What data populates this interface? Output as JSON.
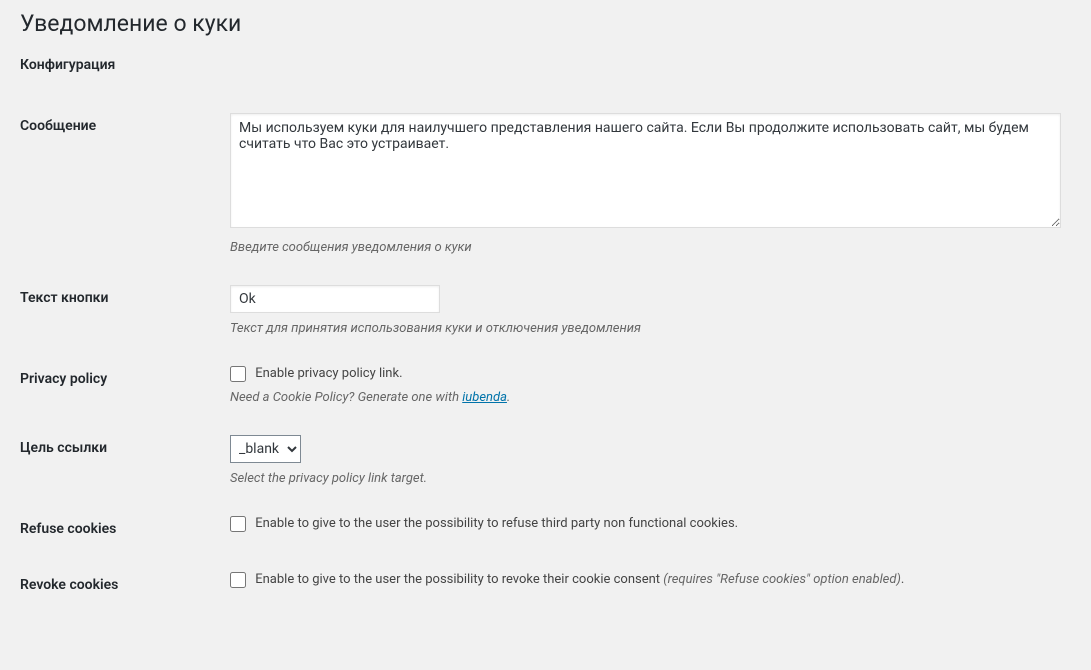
{
  "page": {
    "title": "Уведомление о куки",
    "section_title": "Конфигурация"
  },
  "fields": {
    "message": {
      "label": "Сообщение",
      "value": "Мы используем куки для наилучшего представления нашего сайта. Если Вы продолжите использовать сайт, мы будем считать что Вас это устраивает.",
      "description": "Введите сообщения уведомления о куки"
    },
    "button_text": {
      "label": "Текст кнопки",
      "value": "Ok",
      "description": "Текст для принятия использования куки и отключения уведомления"
    },
    "privacy_policy": {
      "label": "Privacy policy",
      "checkbox_label": "Enable privacy policy link.",
      "description_prefix": "Need a Cookie Policy? Generate one with ",
      "link_text": "iubenda",
      "description_suffix": "."
    },
    "link_target": {
      "label": "Цель ссылки",
      "value": "_blank",
      "description": "Select the privacy policy link target."
    },
    "refuse_cookies": {
      "label": "Refuse cookies",
      "checkbox_label": "Enable to give to the user the possibility to refuse third party non functional cookies."
    },
    "revoke_cookies": {
      "label": "Revoke cookies",
      "checkbox_label": "Enable to give to the user the possibility to revoke their cookie consent ",
      "note": "(requires \"Refuse cookies\" option enabled)",
      "suffix": "."
    }
  }
}
